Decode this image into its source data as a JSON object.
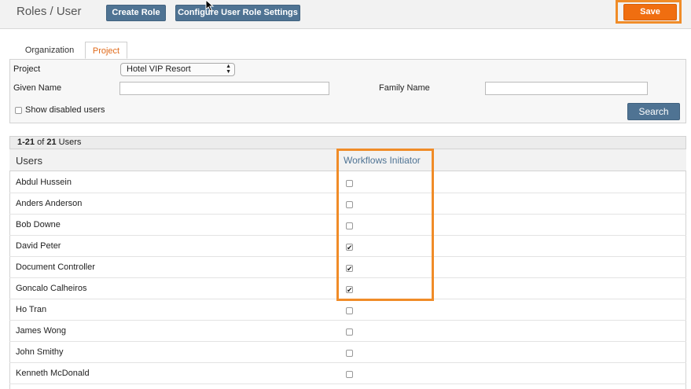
{
  "header": {
    "title": "Roles / User",
    "create_role_label": "Create Role",
    "configure_label": "Configure User Role Settings",
    "save_label": "Save"
  },
  "tabs": [
    {
      "label": "Organization",
      "active": false
    },
    {
      "label": "Project",
      "active": true
    }
  ],
  "filters": {
    "project_label": "Project",
    "project_value": "Hotel VIP Resort",
    "given_name_label": "Given Name",
    "given_name_value": "",
    "family_name_label": "Family Name",
    "family_name_value": "",
    "show_disabled_label": "Show disabled users",
    "show_disabled_checked": false,
    "search_label": "Search"
  },
  "results": {
    "count_range": "1-21",
    "count_of": "of",
    "count_total": "21",
    "count_unit": "Users",
    "col_users": "Users",
    "col_workflows": "Workflows Initiator",
    "rows": [
      {
        "name": "Abdul Hussein",
        "checked": false
      },
      {
        "name": "Anders Anderson",
        "checked": false
      },
      {
        "name": "Bob Downe",
        "checked": false
      },
      {
        "name": "David Peter",
        "checked": true
      },
      {
        "name": "Document Controller",
        "checked": true
      },
      {
        "name": "Goncalo Calheiros",
        "checked": true
      },
      {
        "name": "Ho Tran",
        "checked": false
      },
      {
        "name": "James Wong",
        "checked": false
      },
      {
        "name": "John Smithy",
        "checked": false
      },
      {
        "name": "Kenneth McDonald",
        "checked": false
      }
    ]
  },
  "colors": {
    "accent": "#f06e10",
    "primary_button": "#4f7393",
    "highlight": "#f08c28"
  }
}
